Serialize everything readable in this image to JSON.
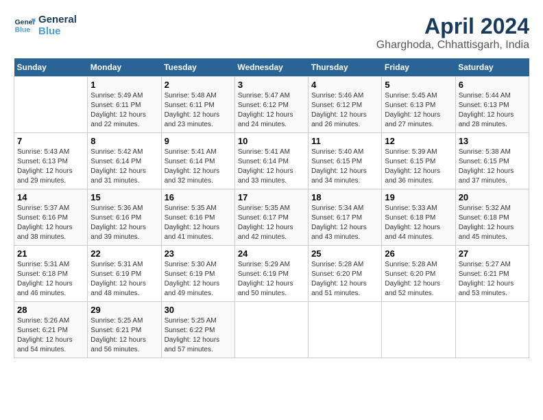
{
  "logo": {
    "line1": "General",
    "line2": "Blue"
  },
  "title": "April 2024",
  "subtitle": "Gharghoda, Chhattisgarh, India",
  "headers": [
    "Sunday",
    "Monday",
    "Tuesday",
    "Wednesday",
    "Thursday",
    "Friday",
    "Saturday"
  ],
  "weeks": [
    [
      {
        "day": "",
        "info": ""
      },
      {
        "day": "1",
        "info": "Sunrise: 5:49 AM\nSunset: 6:11 PM\nDaylight: 12 hours and 22 minutes."
      },
      {
        "day": "2",
        "info": "Sunrise: 5:48 AM\nSunset: 6:11 PM\nDaylight: 12 hours and 23 minutes."
      },
      {
        "day": "3",
        "info": "Sunrise: 5:47 AM\nSunset: 6:12 PM\nDaylight: 12 hours and 24 minutes."
      },
      {
        "day": "4",
        "info": "Sunrise: 5:46 AM\nSunset: 6:12 PM\nDaylight: 12 hours and 26 minutes."
      },
      {
        "day": "5",
        "info": "Sunrise: 5:45 AM\nSunset: 6:13 PM\nDaylight: 12 hours and 27 minutes."
      },
      {
        "day": "6",
        "info": "Sunrise: 5:44 AM\nSunset: 6:13 PM\nDaylight: 12 hours and 28 minutes."
      }
    ],
    [
      {
        "day": "7",
        "info": "Sunrise: 5:43 AM\nSunset: 6:13 PM\nDaylight: 12 hours and 29 minutes."
      },
      {
        "day": "8",
        "info": "Sunrise: 5:42 AM\nSunset: 6:14 PM\nDaylight: 12 hours and 31 minutes."
      },
      {
        "day": "9",
        "info": "Sunrise: 5:41 AM\nSunset: 6:14 PM\nDaylight: 12 hours and 32 minutes."
      },
      {
        "day": "10",
        "info": "Sunrise: 5:41 AM\nSunset: 6:14 PM\nDaylight: 12 hours and 33 minutes."
      },
      {
        "day": "11",
        "info": "Sunrise: 5:40 AM\nSunset: 6:15 PM\nDaylight: 12 hours and 34 minutes."
      },
      {
        "day": "12",
        "info": "Sunrise: 5:39 AM\nSunset: 6:15 PM\nDaylight: 12 hours and 36 minutes."
      },
      {
        "day": "13",
        "info": "Sunrise: 5:38 AM\nSunset: 6:15 PM\nDaylight: 12 hours and 37 minutes."
      }
    ],
    [
      {
        "day": "14",
        "info": "Sunrise: 5:37 AM\nSunset: 6:16 PM\nDaylight: 12 hours and 38 minutes."
      },
      {
        "day": "15",
        "info": "Sunrise: 5:36 AM\nSunset: 6:16 PM\nDaylight: 12 hours and 39 minutes."
      },
      {
        "day": "16",
        "info": "Sunrise: 5:35 AM\nSunset: 6:16 PM\nDaylight: 12 hours and 41 minutes."
      },
      {
        "day": "17",
        "info": "Sunrise: 5:35 AM\nSunset: 6:17 PM\nDaylight: 12 hours and 42 minutes."
      },
      {
        "day": "18",
        "info": "Sunrise: 5:34 AM\nSunset: 6:17 PM\nDaylight: 12 hours and 43 minutes."
      },
      {
        "day": "19",
        "info": "Sunrise: 5:33 AM\nSunset: 6:18 PM\nDaylight: 12 hours and 44 minutes."
      },
      {
        "day": "20",
        "info": "Sunrise: 5:32 AM\nSunset: 6:18 PM\nDaylight: 12 hours and 45 minutes."
      }
    ],
    [
      {
        "day": "21",
        "info": "Sunrise: 5:31 AM\nSunset: 6:18 PM\nDaylight: 12 hours and 46 minutes."
      },
      {
        "day": "22",
        "info": "Sunrise: 5:31 AM\nSunset: 6:19 PM\nDaylight: 12 hours and 48 minutes."
      },
      {
        "day": "23",
        "info": "Sunrise: 5:30 AM\nSunset: 6:19 PM\nDaylight: 12 hours and 49 minutes."
      },
      {
        "day": "24",
        "info": "Sunrise: 5:29 AM\nSunset: 6:19 PM\nDaylight: 12 hours and 50 minutes."
      },
      {
        "day": "25",
        "info": "Sunrise: 5:28 AM\nSunset: 6:20 PM\nDaylight: 12 hours and 51 minutes."
      },
      {
        "day": "26",
        "info": "Sunrise: 5:28 AM\nSunset: 6:20 PM\nDaylight: 12 hours and 52 minutes."
      },
      {
        "day": "27",
        "info": "Sunrise: 5:27 AM\nSunset: 6:21 PM\nDaylight: 12 hours and 53 minutes."
      }
    ],
    [
      {
        "day": "28",
        "info": "Sunrise: 5:26 AM\nSunset: 6:21 PM\nDaylight: 12 hours and 54 minutes."
      },
      {
        "day": "29",
        "info": "Sunrise: 5:25 AM\nSunset: 6:21 PM\nDaylight: 12 hours and 56 minutes."
      },
      {
        "day": "30",
        "info": "Sunrise: 5:25 AM\nSunset: 6:22 PM\nDaylight: 12 hours and 57 minutes."
      },
      {
        "day": "",
        "info": ""
      },
      {
        "day": "",
        "info": ""
      },
      {
        "day": "",
        "info": ""
      },
      {
        "day": "",
        "info": ""
      }
    ]
  ]
}
